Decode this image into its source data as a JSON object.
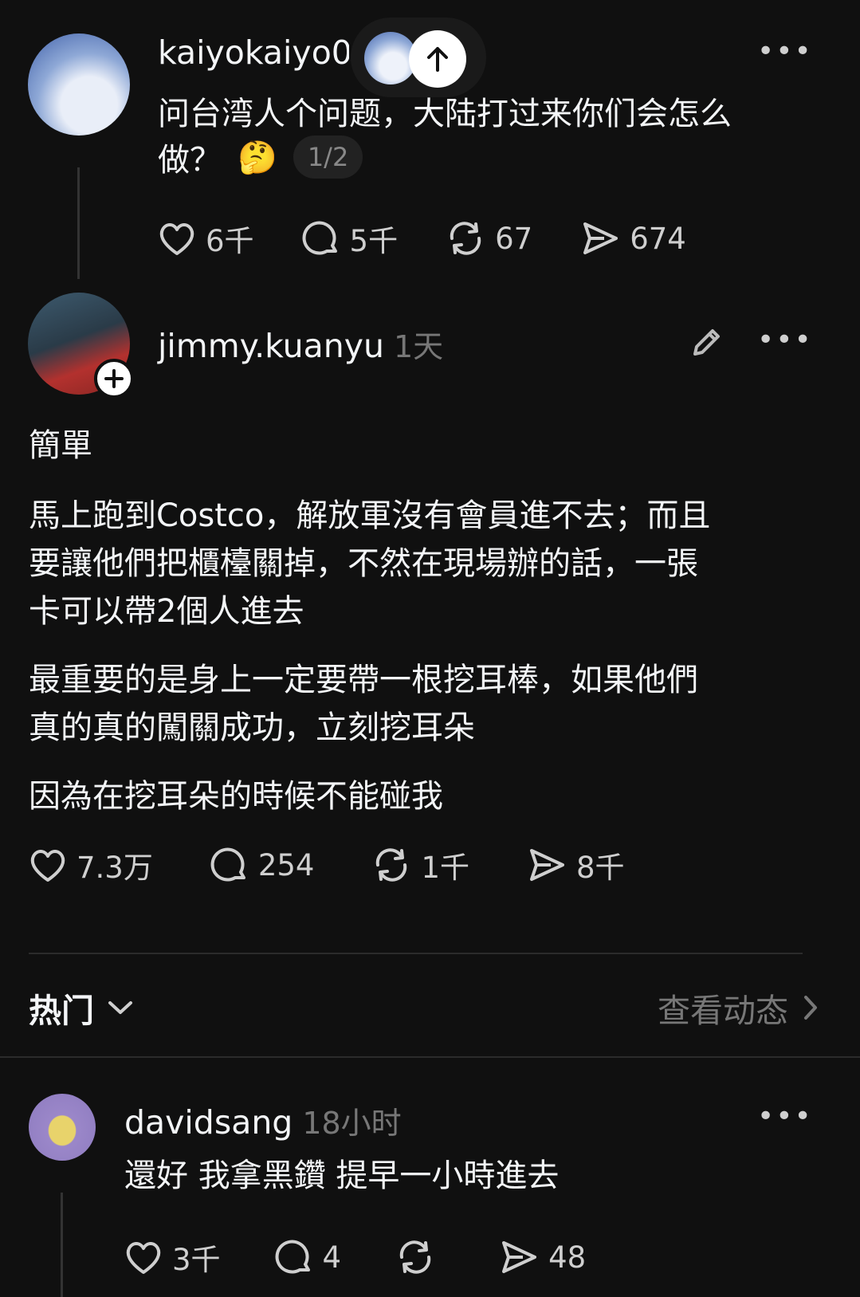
{
  "post1": {
    "username": "kaiyokaiyo08",
    "text_line1": "问台湾人个问题，大陆打过来你们会怎么",
    "text_line2": "做？",
    "emoji": "🤔",
    "page_indicator": "1/2",
    "stats": {
      "likes": "6千",
      "comments": "5千",
      "reposts": "67",
      "shares": "674"
    }
  },
  "post2": {
    "username": "jimmy.kuanyu",
    "time": "1天",
    "paragraphs": [
      "簡單",
      "馬上跑到Costco，解放軍沒有會員進不去；而且",
      "要讓他們把櫃檯關掉，不然在現場辦的話，一張",
      "卡可以帶2個人進去",
      "最重要的是身上一定要帶一根挖耳棒，如果他們",
      "真的真的闖關成功，立刻挖耳朵",
      "因為在挖耳朵的時候不能碰我"
    ],
    "stats": {
      "likes": "7.3万",
      "comments": "254",
      "reposts": "1千",
      "shares": "8千"
    }
  },
  "sort_bar": {
    "label": "热门",
    "view_activity": "查看动态"
  },
  "reply": {
    "username": "davidsang",
    "time": "18小时",
    "text": "還好 我拿黑鑽 提早一小時進去",
    "stats": {
      "likes": "3千",
      "comments": "4",
      "reposts": "",
      "shares": "48"
    }
  },
  "colors": {
    "background": "#101010",
    "text": "#f3f5f7",
    "muted": "#777777",
    "divider": "#2b2b2b"
  }
}
